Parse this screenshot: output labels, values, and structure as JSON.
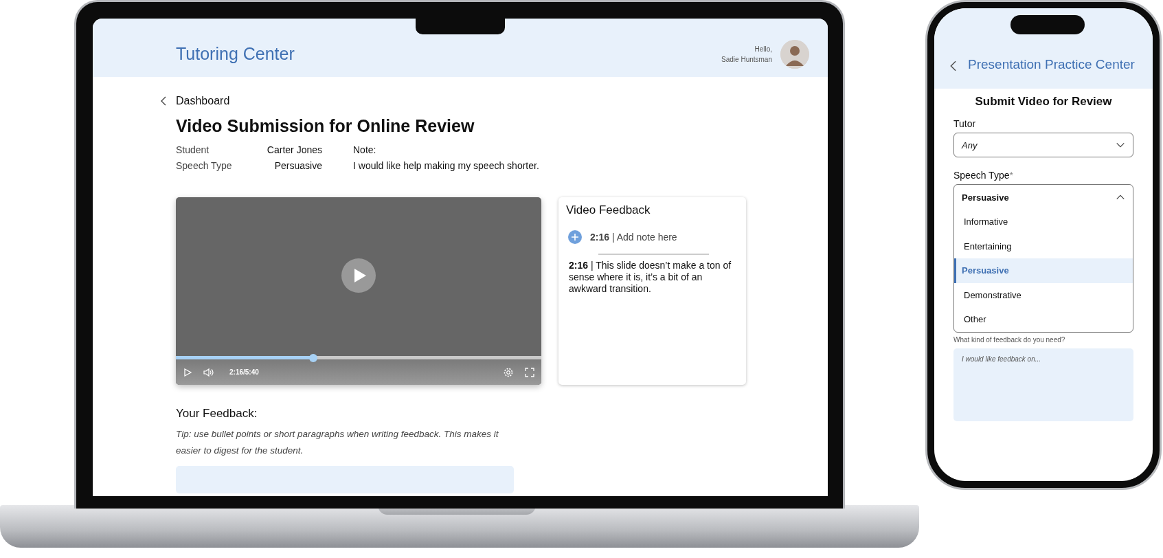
{
  "laptop": {
    "header": {
      "title": "Tutoring Center",
      "greeting": "Hello,",
      "user_name": "Sadie Huntsman"
    },
    "back_link": "Dashboard",
    "page_title": "Video Submission for Online Review",
    "details": [
      {
        "label": "Student",
        "value": "Carter Jones"
      },
      {
        "label": "Speech Type",
        "value": "Persuasive"
      }
    ],
    "note": {
      "label": "Note:",
      "text": "I would like help making my speech shorter."
    },
    "video": {
      "time": "2:16/5:40",
      "level": 0.376
    },
    "feedback_panel": {
      "title": "Video Feedback",
      "separator": "|",
      "add_note": {
        "time": "2:16",
        "placeholder": "Add note here"
      },
      "notes": [
        {
          "time": "2:16",
          "text": "This slide doesn’t make a ton of sense where it is, it’s a bit of an awkward transition."
        }
      ]
    },
    "your_feedback": {
      "heading": "Your Feedback:",
      "tip": "Tip: use bullet points or short paragraphs when writing feedback. This makes it easier to digest for the student."
    }
  },
  "phone": {
    "header": {
      "title": "Presentation Practice Center"
    },
    "heading": "Submit Video for Review",
    "tutor": {
      "label": "Tutor",
      "value": "Any",
      "expanded": false
    },
    "speech_type": {
      "label": "Speech Type",
      "required_mark": "*",
      "value": "Persuasive",
      "expanded": true,
      "options": [
        {
          "label": "Informative",
          "selected": false
        },
        {
          "label": "Entertaining",
          "selected": false
        },
        {
          "label": "Persuasive",
          "selected": true
        },
        {
          "label": "Demonstrative",
          "selected": false
        },
        {
          "label": "Other",
          "selected": false
        }
      ]
    },
    "feedback_field": {
      "label": "What kind of feedback do you need?",
      "placeholder": "I would like feedback on..."
    }
  }
}
